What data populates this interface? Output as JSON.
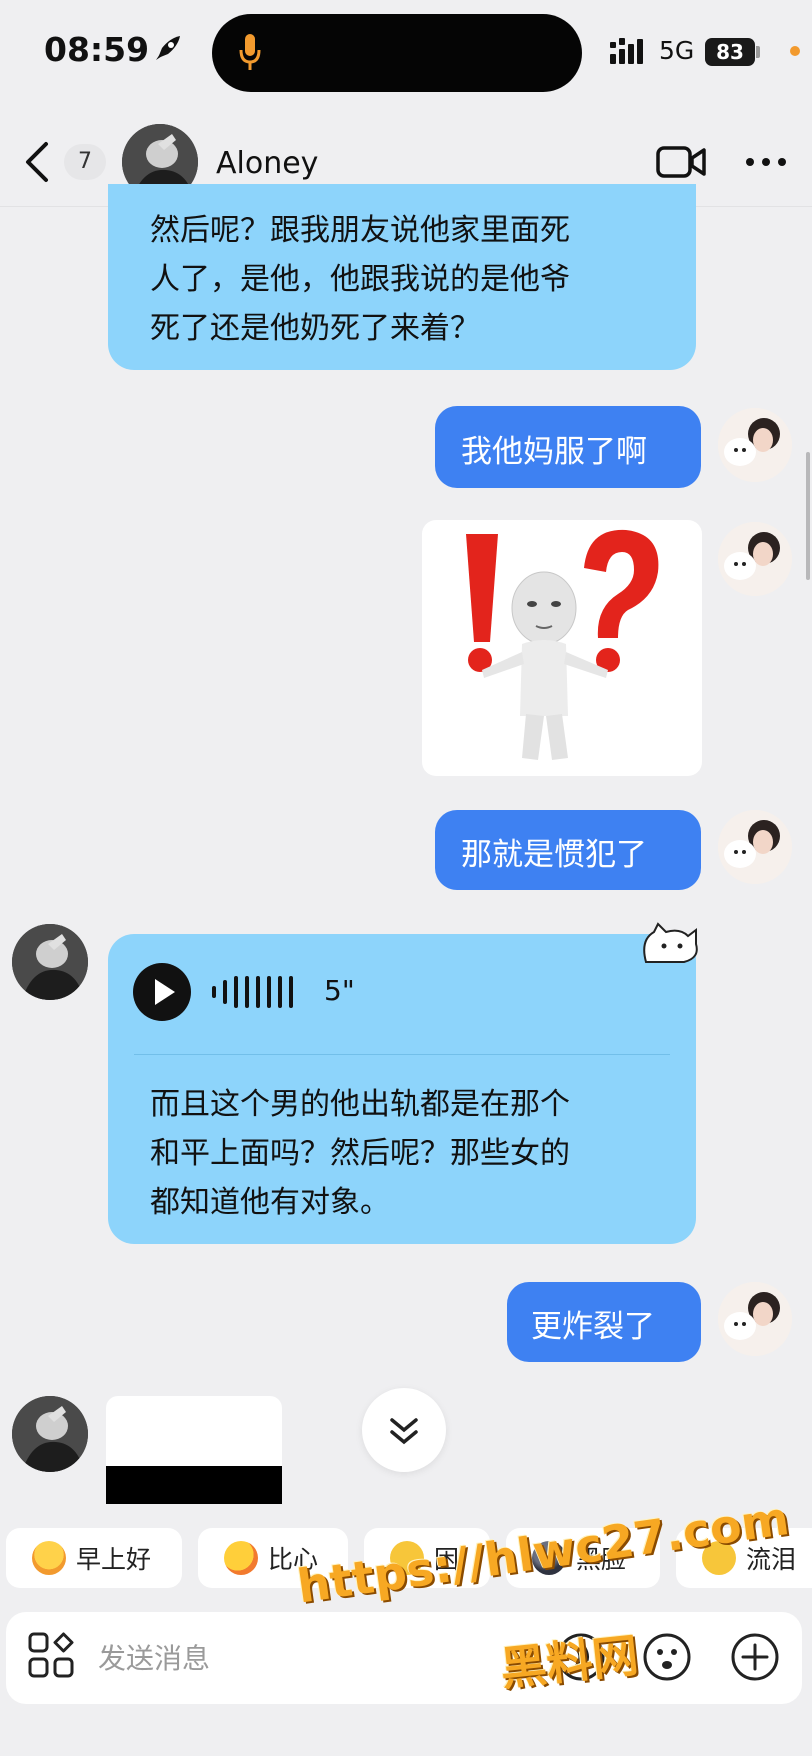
{
  "status_bar": {
    "time": "08:59",
    "network": "5G",
    "battery": "83"
  },
  "header": {
    "unread_count": "7",
    "contact_name": "Aloney"
  },
  "messages": [
    {
      "direction": "incoming",
      "type": "text",
      "lines": [
        "然后呢？跟我朋友说他家里面死",
        "人了，是他，他跟我说的是他爷",
        "死了还是他奶死了来着？"
      ]
    },
    {
      "direction": "outgoing",
      "type": "text",
      "text": "我他妈服了啊"
    },
    {
      "direction": "outgoing",
      "type": "sticker",
      "sticker": "confused-figure-exclamation-question"
    },
    {
      "direction": "outgoing",
      "type": "text",
      "text": "那就是惯犯了"
    },
    {
      "direction": "incoming",
      "type": "voice",
      "duration": "5\"",
      "transcript_lines": [
        "而且这个男的他出轨都是在那个",
        "和平上面吗？然后呢？那些女的",
        "都知道他有对象。"
      ]
    },
    {
      "direction": "outgoing",
      "type": "text",
      "text": "更炸裂了"
    }
  ],
  "quick_replies": [
    {
      "label": "早上好",
      "emoji": "sun-emoji"
    },
    {
      "label": "比心",
      "emoji": "heart-hands-emoji"
    },
    {
      "label": "困",
      "emoji": "sleepy-emoji"
    },
    {
      "label": "黑脸",
      "emoji": "dark-face-emoji"
    },
    {
      "label": "流泪",
      "emoji": "crying-emoji"
    }
  ],
  "input": {
    "placeholder": "发送消息"
  },
  "watermark": {
    "line1": "https://hlwc27.com",
    "line2": "黑料网"
  },
  "colors": {
    "incoming_bubble": "#8dd4fb",
    "outgoing_bubble": "#3e81f2",
    "accent_orange": "#f29a2e"
  }
}
